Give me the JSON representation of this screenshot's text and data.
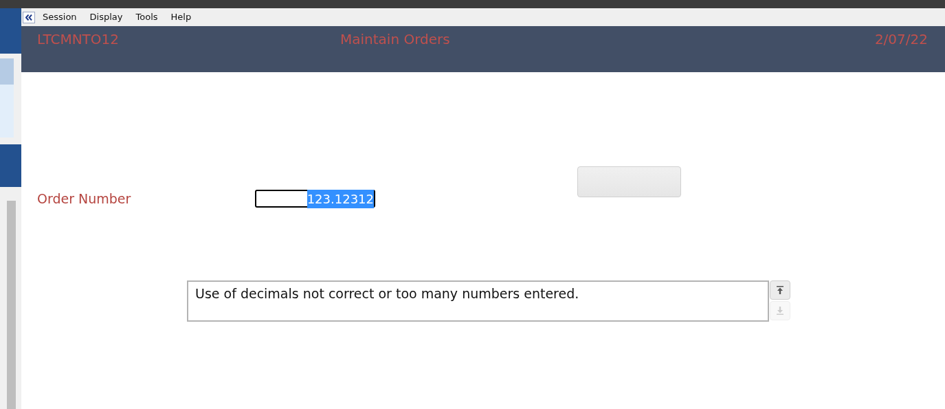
{
  "menu": [
    "Session",
    "Display",
    "Tools",
    "Help"
  ],
  "header": {
    "program_id": "LTCMNTO12",
    "title": "Maintain Orders",
    "date": "2/07/22"
  },
  "form": {
    "label": "Order Number",
    "value": "123.12312",
    "value_highlighted": true
  },
  "message": {
    "text": "Use of decimals not correct or too many numbers entered.",
    "scroll_up_disabled": false,
    "scroll_down_disabled": true
  }
}
